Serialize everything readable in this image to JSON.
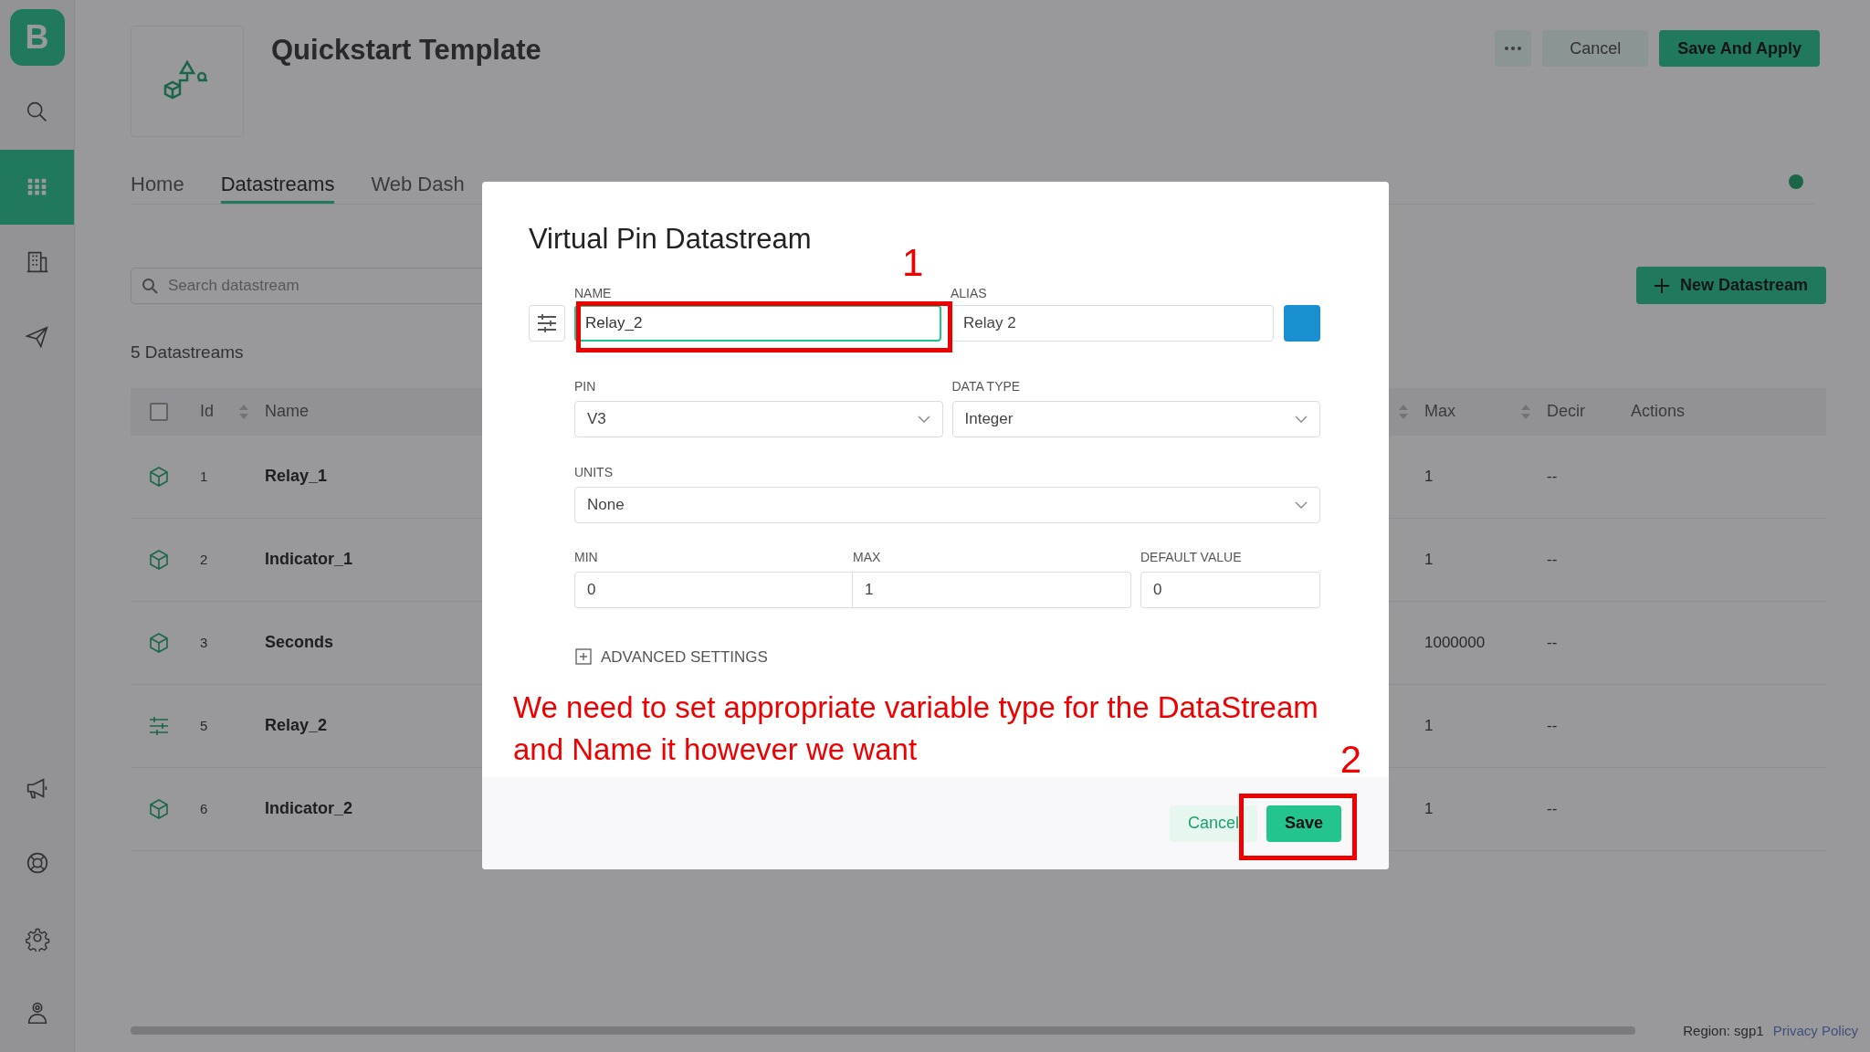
{
  "sidebar": {
    "logo": "B",
    "items": [
      {
        "kind": "search",
        "selected": false
      },
      {
        "kind": "grid",
        "selected": true
      },
      {
        "kind": "building",
        "selected": false
      },
      {
        "kind": "send",
        "selected": false
      },
      {
        "kind": "megaphone",
        "selected": false
      },
      {
        "kind": "lifebuoy",
        "selected": false
      },
      {
        "kind": "gear",
        "selected": false
      },
      {
        "kind": "user",
        "selected": false
      }
    ]
  },
  "header": {
    "title": "Quickstart Template",
    "buttons": [
      {
        "kind": "more"
      },
      {
        "kind": "secondary",
        "label": "Cancel"
      },
      {
        "kind": "primary",
        "label": "Save And Apply"
      }
    ]
  },
  "tabs": [
    {
      "label": "Home",
      "selected": false
    },
    {
      "label": "Datastreams",
      "selected": true
    },
    {
      "label": "Web Dash",
      "selected": false
    }
  ],
  "search": {
    "placeholder": "Search datastream"
  },
  "new_button": "New Datastream",
  "count": "5 Datastreams",
  "table": {
    "select_all": {
      "checked": false
    },
    "columns": [
      "Id",
      "Name",
      "Max",
      "Decir",
      "Actions"
    ],
    "rows": [
      {
        "kind": "cube",
        "id": "1",
        "name": "Relay_1",
        "max": "1",
        "decimals": "--"
      },
      {
        "kind": "cube",
        "id": "2",
        "name": "Indicator_1",
        "max": "1",
        "decimals": "--"
      },
      {
        "kind": "cube",
        "id": "3",
        "name": "Seconds",
        "max": "1000000",
        "decimals": "--"
      },
      {
        "kind": "sliders",
        "id": "5",
        "name": "Relay_2",
        "max": "1",
        "decimals": "--"
      },
      {
        "kind": "cube",
        "id": "6",
        "name": "Indicator_2",
        "max": "1",
        "decimals": "--"
      }
    ]
  },
  "modal": {
    "title": "Virtual Pin Datastream",
    "name": {
      "label": "NAME",
      "value": "Relay_2"
    },
    "alias": {
      "label": "ALIAS",
      "value": "Relay 2",
      "color": "#1a8fd0"
    },
    "pin": {
      "label": "PIN",
      "value": "V3"
    },
    "data_type": {
      "label": "DATA TYPE",
      "value": "Integer"
    },
    "units": {
      "label": "UNITS",
      "value": "None"
    },
    "min": {
      "label": "MIN",
      "value": "0"
    },
    "max": {
      "label": "MAX",
      "value": "1"
    },
    "default": {
      "label": "DEFAULT VALUE",
      "value": "0"
    },
    "advanced": {
      "label": "ADVANCED SETTINGS",
      "expanded": false
    },
    "cancel": "Cancel",
    "save": "Save"
  },
  "annotations": {
    "markers": [
      "1",
      "2"
    ],
    "note": "We need to set appropriate variable type for the DataStream and Name it however we want"
  },
  "footer": {
    "region": "Region: sgp1",
    "link": "Privacy Policy"
  }
}
